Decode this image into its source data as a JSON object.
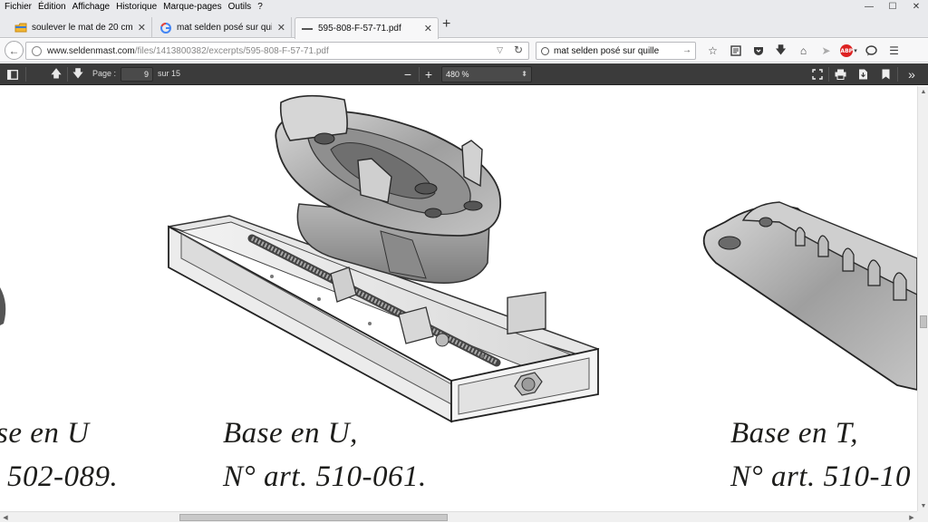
{
  "menubar": {
    "items": [
      "Fichier",
      "Édition",
      "Affichage",
      "Historique",
      "Marque-pages",
      "Outils",
      "?"
    ]
  },
  "window_controls": {
    "minimize": "—",
    "maximize": "☐",
    "close": "✕"
  },
  "tabs": [
    {
      "label": "soulever le mat de 20 cm s...",
      "icon": "folder-favicon",
      "active": false
    },
    {
      "label": "mat selden posé sur quille ...",
      "icon": "google-favicon",
      "active": false
    },
    {
      "label": "595-808-F-57-71.pdf",
      "icon": "pdf-favicon",
      "active": true
    }
  ],
  "new_tab_label": "+",
  "tab_close_label": "✕",
  "navbar": {
    "url_domain": "www.seldenmast.com",
    "url_path": "/files/1413800382/excerpts/595-808-F-57-71.pdf",
    "search_value": "mat selden posé sur quille",
    "icons": [
      "star-icon",
      "reading-list-icon",
      "pocket-icon",
      "download-icon",
      "home-icon",
      "send-icon",
      "adblock-icon",
      "chat-icon",
      "menu-icon"
    ],
    "abp_label": "ABP"
  },
  "pdf_toolbar": {
    "page_label": "Page :",
    "page_value": "9",
    "page_total": "sur 15",
    "zoom_out": "−",
    "zoom_in": "+",
    "zoom_value": "480 %"
  },
  "document": {
    "captions": [
      {
        "line1": "se en U",
        "line2": "502-089."
      },
      {
        "line1": "Base en U,",
        "line2": "N° art. 510-061."
      },
      {
        "line1": "Base en T,",
        "line2": "N° art. 510-10"
      }
    ]
  }
}
